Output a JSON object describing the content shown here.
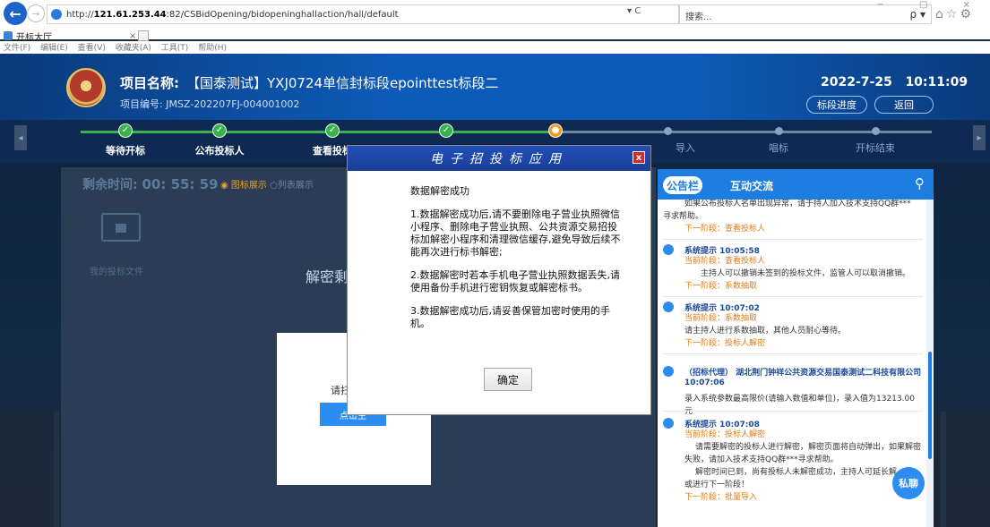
{
  "browser": {
    "url_prefix": "http://",
    "url_host": "121.61.253.44",
    "url_path": ":82/CSBidOpening/bidopeninghallaction/hall/default",
    "url_tools": "▾ C",
    "search_placeholder": "搜索...",
    "search_tools": "ρ ▾",
    "tab_title": "开标大厅",
    "tab_close": "×",
    "window_icons": "⌂☆⚙",
    "window_controls": "− ▢ ×",
    "menu": [
      "文件(F)",
      "编辑(E)",
      "查看(V)",
      "收藏夹(A)",
      "工具(T)",
      "帮助(H)"
    ]
  },
  "header": {
    "project_name_label": "项目名称:",
    "project_name": "【国泰测试】YXJ0724单信封标段epointtest标段二",
    "project_no": "项目编号: JMSZ-202207FJ-004001002",
    "date": "2022-7-25",
    "time": "10:11:09",
    "btn_progress": "标段进度",
    "btn_back": "返回"
  },
  "steps": [
    {
      "name": "等待开标",
      "status": "done"
    },
    {
      "name": "公布投标人",
      "status": "done"
    },
    {
      "name": "查看投标",
      "status": "done"
    },
    {
      "name": "",
      "status": "done"
    },
    {
      "name": "",
      "status": "current"
    },
    {
      "name": "导入",
      "status": "todo"
    },
    {
      "name": "唱标",
      "status": "todo"
    },
    {
      "name": "开标结束",
      "status": "todo"
    }
  ],
  "left": {
    "timer_label": "剩余时间:",
    "timer_value": "00: 55: 59",
    "view_icon": "◉",
    "view_option_1": "图标展示",
    "view_option_2": "○列表展示",
    "folder_label": "我的投标文件",
    "decrypt_text": "解密剩",
    "inner_text": "请扫",
    "inner_button": "点击生"
  },
  "bulletin": {
    "tab_active": "公告栏",
    "tab_other": "互动交流",
    "entries": [
      {
        "lines": [
          "如果公布投标人名单出现异常，请于持人加入技术支持QQ群***",
          "寻求帮助。"
        ],
        "next": "下一阶段：查看投标人"
      },
      {
        "title": "系统提示 10:05:58",
        "current": "当前阶段：查看投标人",
        "lines": [
          "主持人可以撤销未签到的投标文件，监管人可以取消撤销。"
        ],
        "next": "下一阶段：系数抽取"
      },
      {
        "title": "系统提示 10:07:02",
        "current": "当前阶段：系数抽取",
        "lines": [
          "请主持人进行系数抽取，其他人员耐心等待。"
        ],
        "next": "下一阶段：投标人解密"
      },
      {
        "title": "（招标代理） 湖北荆门钟祥公共资源交易国泰测试二科技有限公司",
        "time": "10:07:06",
        "lines": [
          "录入系统参数最高限价(请输入数值和单位)，录入值为13213.00元"
        ]
      },
      {
        "title": "系统提示 10:07:08",
        "current": "当前阶段：投标人解密",
        "lines": [
          "请需要解密的投标人进行解密，解密页面将自动弹出，如果解密",
          "失败，请加入技术支持QQ群***寻求帮助。",
          "解密时间已到，尚有投标人未解密成功，主持人可延长解",
          "或进行下一阶段！"
        ],
        "next": "下一阶段：批量导入"
      }
    ],
    "chat_label": "私聊"
  },
  "modal": {
    "title": "电子招投标应用",
    "close": "x",
    "heading": "数据解密成功",
    "para1": "1.数据解密成功后,请不要删除电子营业执照微信小程序、删除电子营业执照、公共资源交易招投标加解密小程序和清理微信缓存,避免导致后续不能再次进行标书解密;",
    "para2": "2.数据解密时若本手机电子营业执照数据丢失,请使用备份手机进行密钥恢复或解密标书。",
    "para3": "3.数据解密成功后,请妥善保管加密时使用的手机。",
    "ok": "确定"
  },
  "colors": {
    "accent": "#1d7de0",
    "done": "#38b34a",
    "current": "#f39a1f",
    "close": "#d22a2a"
  }
}
